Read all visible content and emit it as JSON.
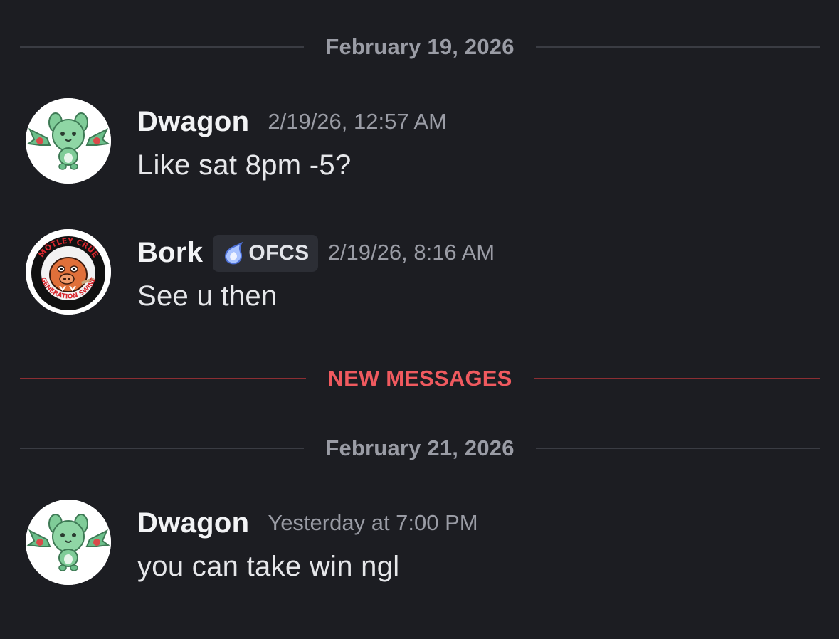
{
  "dividers": {
    "date_1": "February 19, 2026",
    "new_messages": "NEW MESSAGES",
    "date_2": "February 21, 2026"
  },
  "messages": [
    {
      "username": "Dwagon",
      "timestamp": "2/19/26, 12:57 AM",
      "content": "Like sat 8pm -5?",
      "avatar": "green-pokemon-avatar"
    },
    {
      "username": "Bork",
      "tag": "OFCS",
      "tag_icon": "blue-flame-icon",
      "timestamp": "2/19/26, 8:16 AM",
      "content": "See u then",
      "avatar": "motley-crue-generation-swine-avatar",
      "avatar_text_top": "MÖTLEY CRÜE",
      "avatar_text_bottom": "GENERATION SWINE"
    },
    {
      "username": "Dwagon",
      "timestamp": "Yesterday at 7:00 PM",
      "content": "you can take win ngl",
      "avatar": "green-pokemon-avatar"
    }
  ],
  "colors": {
    "background": "#1c1d22",
    "new_messages": "#f05a5f",
    "muted_text": "#9a9ca5"
  }
}
